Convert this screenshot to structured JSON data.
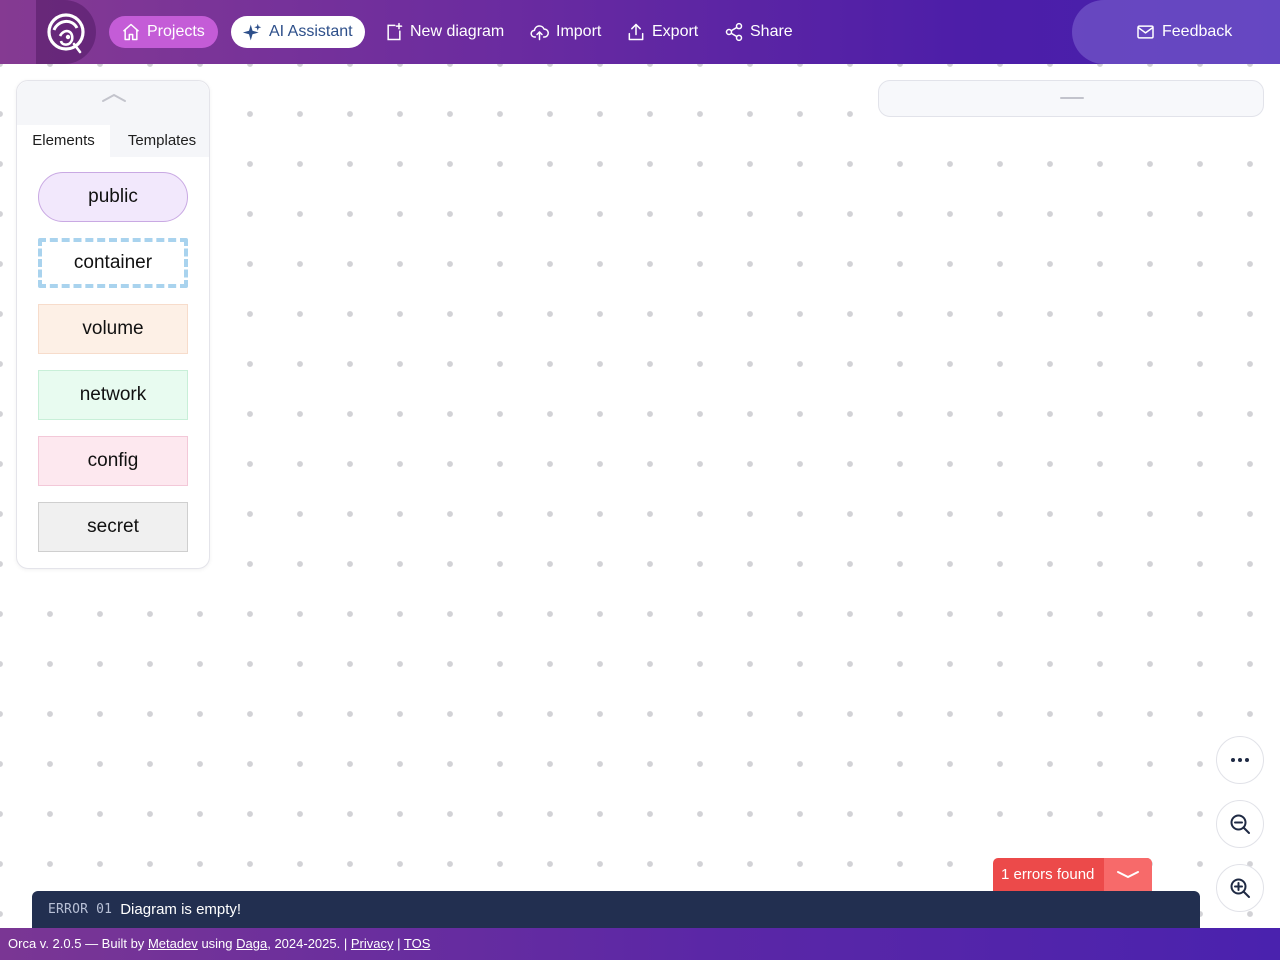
{
  "header": {
    "nav": {
      "projects": "Projects",
      "ai_assistant": "AI Assistant",
      "new_diagram": "New diagram",
      "import": "Import",
      "export": "Export",
      "share": "Share"
    },
    "feedback": "Feedback"
  },
  "palette": {
    "tabs": [
      {
        "label": "Elements",
        "active": true
      },
      {
        "label": "Templates",
        "active": false
      }
    ],
    "elements": [
      {
        "label": "public"
      },
      {
        "label": "container"
      },
      {
        "label": "volume"
      },
      {
        "label": "network"
      },
      {
        "label": "config"
      },
      {
        "label": "secret"
      }
    ]
  },
  "errors": {
    "summary": "1 errors found",
    "items": [
      {
        "code": "ERROR 01",
        "message": "Diagram is empty!"
      }
    ]
  },
  "footer": {
    "prefix": "Orca v. 2.0.5 — Built by",
    "author": "Metadev",
    "using": "using",
    "lib": "Daga",
    "years": ", 2024-2025. |",
    "privacy": "Privacy",
    "sep": "|",
    "tos": "TOS"
  },
  "colors": {
    "accent": "#c45cd7",
    "error": "#ec4a4a",
    "error_panel": "#222f50"
  },
  "icons": {
    "logo": "orca-logo-icon",
    "projects": "home-icon",
    "ai": "sparkles-icon",
    "new": "new-file-icon",
    "import": "cloud-upload-icon",
    "export": "upload-icon",
    "share": "share-icon",
    "feedback": "mail-icon",
    "more": "more-horizontal-icon",
    "zoom_out": "zoom-out-icon",
    "zoom_in": "zoom-in-icon"
  }
}
